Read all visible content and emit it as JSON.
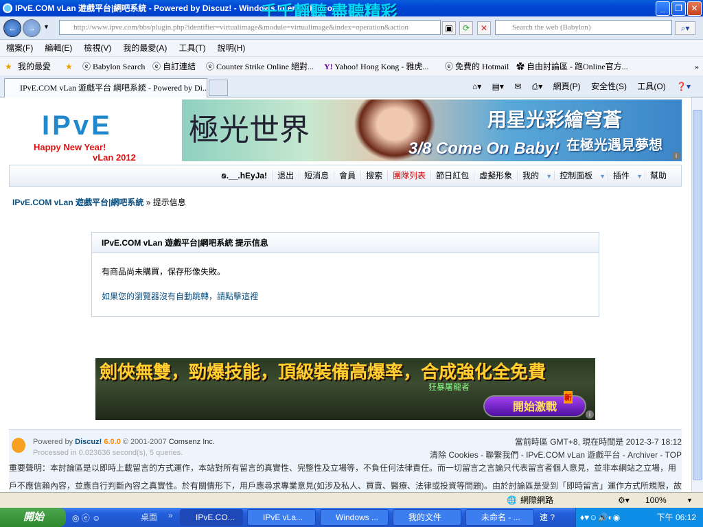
{
  "window": {
    "title": "IPvE.COM vLan 遊戲平台|網吧系統 - Powered by Discuz! - Windows Internet Explorer",
    "overlay_text": "千千靜聽 盡聽精彩"
  },
  "address": {
    "url": "http://www.ipve.com/bbs/plugin.php?identifier=virtualimage&module=virtualimage&index=operation&action",
    "search_placeholder": "Search the web (Babylon)"
  },
  "menu": [
    "檔案(F)",
    "編輯(E)",
    "檢視(V)",
    "我的最愛(A)",
    "工具(T)",
    "說明(H)"
  ],
  "favorites": {
    "label": "我的最愛",
    "items": [
      "Babylon Search",
      "自訂連結",
      "Counter Strike Online 絕對...",
      "Yahoo! Hong Kong - 雅虎...",
      "免費的 Hotmail",
      "自由討論區 - 跑Online官方..."
    ]
  },
  "tab": {
    "label": "IPvE.COM vLan 遊戲平台 網吧系統 - Powered by Di..."
  },
  "command_bar": {
    "page": "網頁(P)",
    "safety": "安全性(S)",
    "tools": "工具(O)"
  },
  "logo": {
    "brand": "IPvE",
    "greeting": "Happy New Year!",
    "sub": "vLan 2012"
  },
  "top_banner": {
    "title": "極光世界",
    "tagline": "3/8 Come On Baby!",
    "slogan1": "用星光彩繪穹蒼",
    "slogan2": "在極光遇見夢想"
  },
  "nav": {
    "user": "ꞩ.__.hEyJa!",
    "items": [
      "退出",
      "短消息",
      "會員",
      "搜索",
      "團隊列表",
      "節日紅包",
      "虛擬形象",
      "我的",
      "控制面板",
      "插件",
      "幫助"
    ]
  },
  "breadcrumb": {
    "home": "IPvE.COM vLan 遊戲平台|網吧系統",
    "sep": "»",
    "current": "提示信息"
  },
  "message": {
    "header": "IPvE.COM vLan 遊戲平台|網吧系統 提示信息",
    "text": "有商品尚未購買，保存形像失敗。",
    "redirect_link": "如果您的瀏覽器沒有自動跳轉，請點擊這裡"
  },
  "ad_banner": {
    "headline": "劍俠無雙，勁爆技能，頂級裝備高爆率，合成強化全免費",
    "character": "狂暴屠龍者",
    "button": "開始激戰",
    "badge": "新"
  },
  "footer": {
    "powered_prefix": "Powered by",
    "product": "Discuz!",
    "version": "6.0.0",
    "copyright": "© 2001-2007",
    "company": "Comsenz Inc.",
    "processed": "Processed in 0.023636 second(s), 5 queries.",
    "time": "當前時區 GMT+8, 現在時間是 2012-3-7 18:12",
    "links": "清除 Cookies - 聯繫我們 - IPvE.COM vLan 遊戲平台 - Archiver - TOP",
    "disclaimer": "重要聲明：本討論區是以即時上載留言的方式運作，本站對所有留言的真實性、完整性及立場等，不負任何法律責任。而一切留言之言論只代表留言者個人意見，並非本網站之立場，用戶不應信賴內容，並應自行判斷內容之真實性。於有關情形下，用戶應尋求專業意見(如涉及私人、買賣、醫療、法律或投資等問題)。由於討論區是受到「即時留言」運作方式所規限，故不能完全監察所有即時留言，若讀者發現有留言出現問題，請聯絡我們。本站有權刪除任何留言及拒絕任何人士留"
  },
  "status": {
    "zone": "網際網路",
    "zoom": "100%"
  },
  "taskbar": {
    "start": "開始",
    "desktop": "桌面",
    "tasks": [
      "IPvE.CO...",
      "IPvE vLa...",
      "Windows ...",
      "我的文件",
      "未命名 - ..."
    ],
    "clock": "下午 06:12"
  }
}
